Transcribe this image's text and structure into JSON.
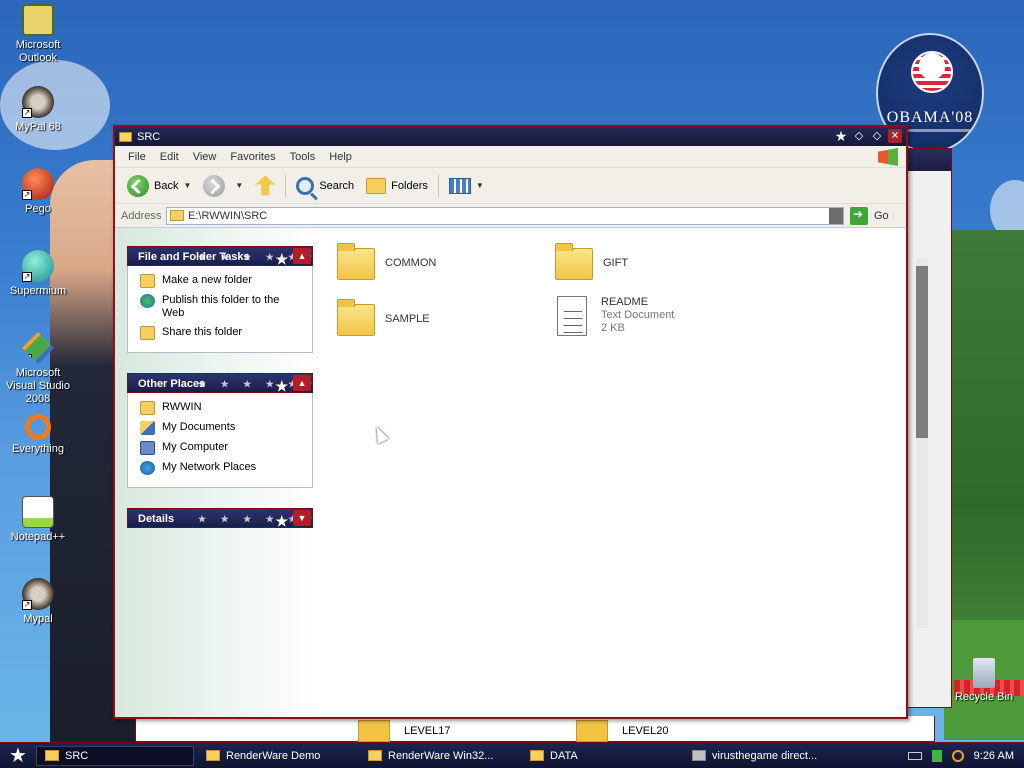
{
  "desktop": {
    "icons": [
      {
        "label": "Microsoft Outlook",
        "icon": "outlook-icon"
      },
      {
        "label": "MyPal 68",
        "icon": "raccoon-icon"
      },
      {
        "label": "Pego",
        "icon": "orb-icon"
      },
      {
        "label": "Supermium",
        "icon": "browser-icon"
      },
      {
        "label": "Microsoft Visual Studio 2008",
        "icon": "visual-studio-icon"
      },
      {
        "label": "Everything",
        "icon": "search-ring-icon"
      },
      {
        "label": "Notepad++",
        "icon": "notepad-icon"
      },
      {
        "label": "Mypal",
        "icon": "raccoon-icon"
      }
    ],
    "recycle_bin_label": "Recycle Bin",
    "campaign_badge": "OBAMA'08"
  },
  "window": {
    "title": "SRC",
    "menu": [
      "File",
      "Edit",
      "View",
      "Favorites",
      "Tools",
      "Help"
    ],
    "toolbar": {
      "back": "Back",
      "search": "Search",
      "folders": "Folders"
    },
    "address": {
      "label": "Address",
      "value": "E:\\RWWIN\\SRC",
      "go": "Go"
    }
  },
  "panes": {
    "file_tasks": {
      "title": "File and Folder Tasks",
      "items": [
        "Make a new folder",
        "Publish this folder to the Web",
        "Share this folder"
      ]
    },
    "other_places": {
      "title": "Other Places",
      "items": [
        "RWWIN",
        "My Documents",
        "My Computer",
        "My Network Places"
      ]
    },
    "details": {
      "title": "Details"
    }
  },
  "files": [
    {
      "name": "COMMON",
      "type": "folder"
    },
    {
      "name": "GIFT",
      "type": "folder"
    },
    {
      "name": "SAMPLE",
      "type": "folder"
    },
    {
      "name": "README",
      "type": "text",
      "kind": "Text Document",
      "size": "2 KB"
    }
  ],
  "background_window": {
    "items": [
      "LEVEL17",
      "LEVEL20"
    ]
  },
  "taskbar": {
    "items": [
      "SRC",
      "RenderWare Demo",
      "RenderWare Win32...",
      "DATA",
      "virusthegame direct..."
    ],
    "clock": "9:26 AM"
  },
  "colors": {
    "titlebar": "#1a1d4a",
    "frame": "#8e0f1a",
    "accent_red": "#b31d28"
  }
}
